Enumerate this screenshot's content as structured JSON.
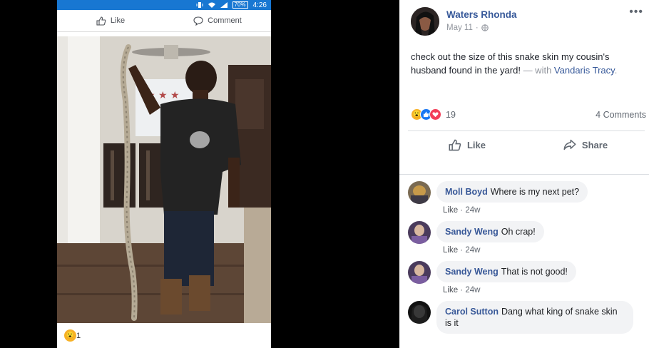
{
  "phone": {
    "status_time": "4:26",
    "battery": "70%",
    "like_label": "Like",
    "comment_label": "Comment",
    "reaction_count": "1"
  },
  "post": {
    "author": "Waters Rhonda",
    "date": "May 11",
    "privacy_icon": "globe-icon",
    "text": "check out the size of this snake skin my cousin's husband found in the yard!",
    "with_prefix": " — with ",
    "tagged": "Vandaris Tracy",
    "tagged_suffix": ".",
    "reaction_count": "19",
    "comment_count": "4 Comments",
    "like_label": "Like",
    "share_label": "Share"
  },
  "comments": [
    {
      "name": "Moll Boyd",
      "text": "Where is my next pet?",
      "like": "Like",
      "time": "24w"
    },
    {
      "name": "Sandy Weng",
      "text": "Oh crap!",
      "like": "Like",
      "time": "24w"
    },
    {
      "name": "Sandy Weng",
      "text": "That is not good!",
      "like": "Like",
      "time": "24w"
    },
    {
      "name": "Carol Sutton",
      "text": "Dang what king of snake skin is it"
    }
  ],
  "colors": {
    "facebook_blue": "#1877d2",
    "name_link": "#365899",
    "love": "#f33e58",
    "like": "#1877f2",
    "wow": "#f7b125"
  }
}
